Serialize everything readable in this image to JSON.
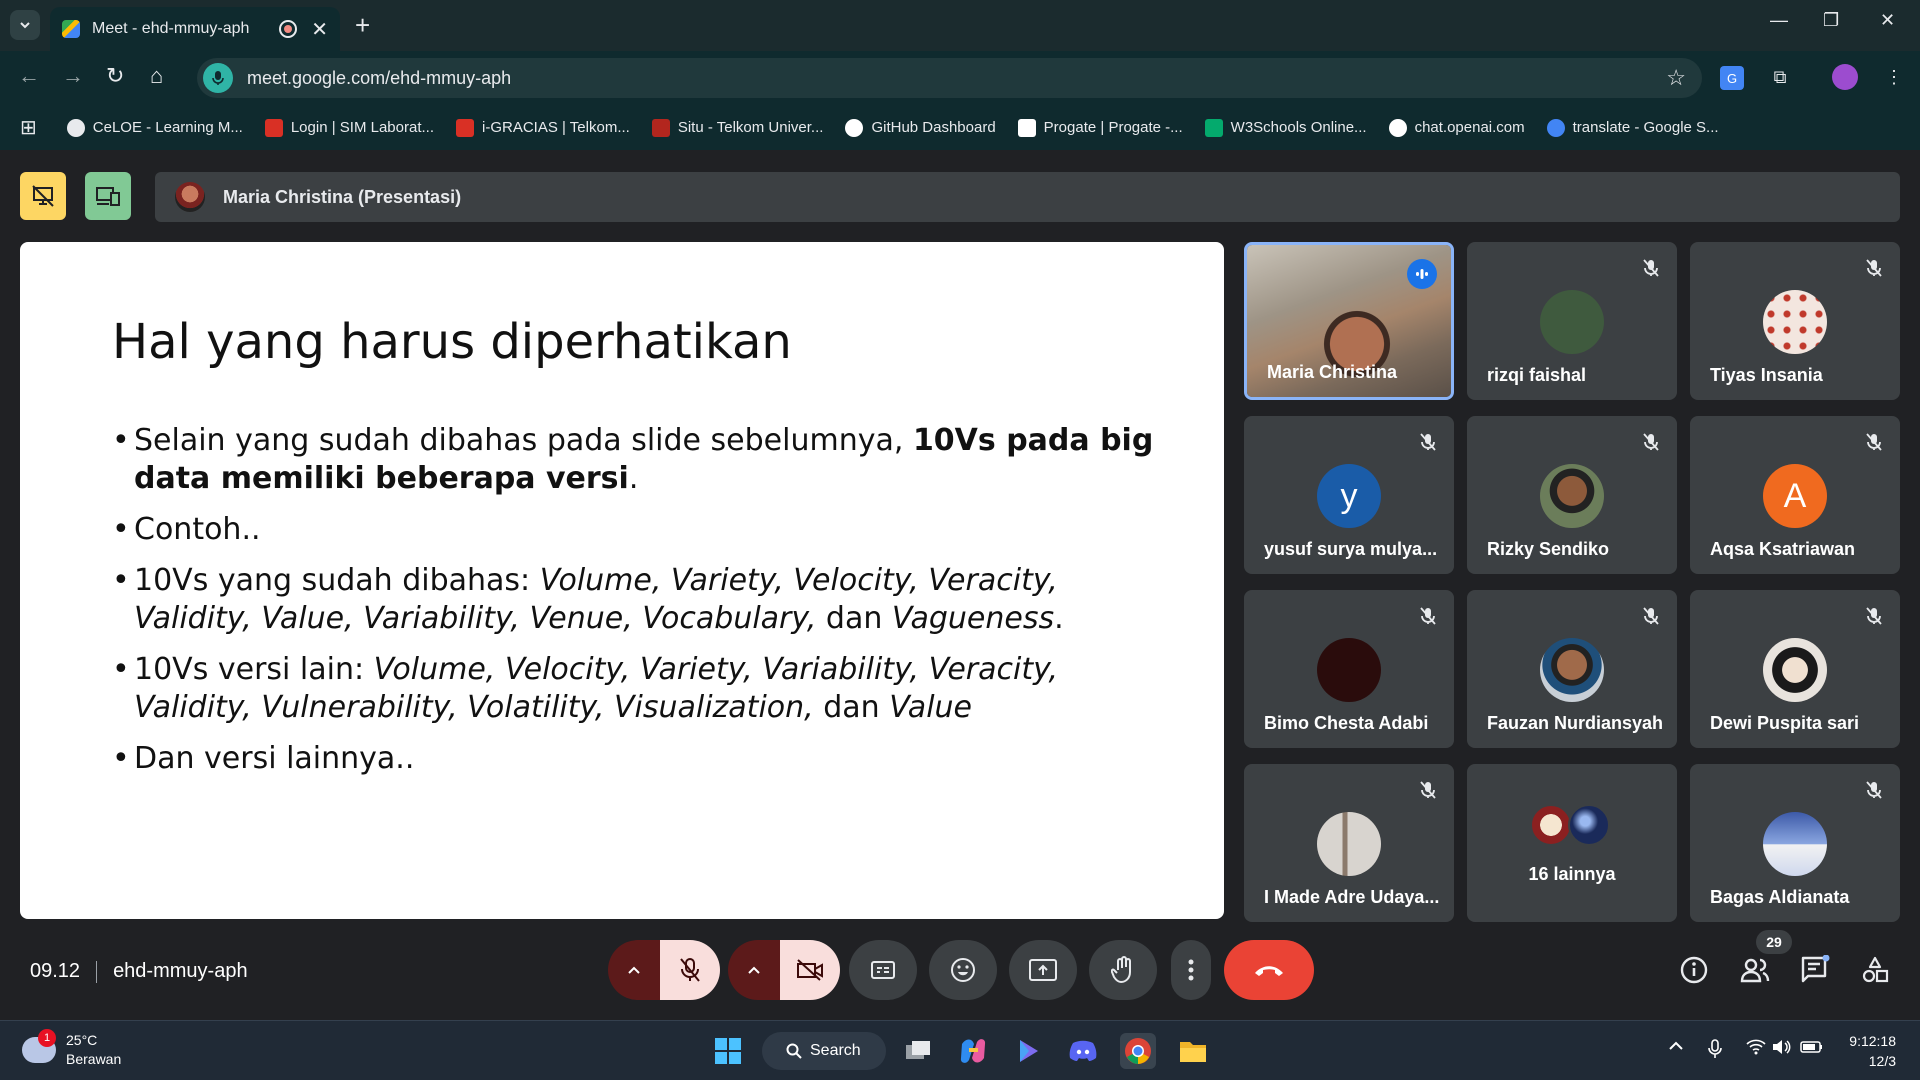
{
  "browser": {
    "tab_title": "Meet - ehd-mmuy-aph",
    "url": "meet.google.com/ehd-mmuy-aph",
    "bookmarks": [
      {
        "label": "CeLOE - Learning M...",
        "color": "#e8eaed"
      },
      {
        "label": "Login | SIM Laborat...",
        "color": "#d93025"
      },
      {
        "label": "i-GRACIAS | Telkom...",
        "color": "#d93025"
      },
      {
        "label": "Situ - Telkom Univer...",
        "color": "#b3261e"
      },
      {
        "label": "GitHub Dashboard",
        "color": "#ffffff"
      },
      {
        "label": "Progate | Progate -...",
        "color": "#ffffff"
      },
      {
        "label": "W3Schools Online...",
        "color": "#04aa6d"
      },
      {
        "label": "chat.openai.com",
        "color": "#ffffff"
      },
      {
        "label": "translate - Google S...",
        "color": "#4285f4"
      }
    ]
  },
  "meet": {
    "presenter_label": "Maria Christina (Presentasi)",
    "slide": {
      "title": "Hal yang harus diperhatikan",
      "bullet1_plain": "Selain yang sudah dibahas pada slide sebelumnya, ",
      "bullet1_bold": "10Vs pada big data memiliki beberapa versi",
      "bullet1_end": ".",
      "bullet2": "Contoh..",
      "bullet3_plain": "10Vs yang sudah dibahas:  ",
      "bullet3_italic": "Volume, Variety, Velocity, Veracity, Validity, Value, Variability, Venue, Vocabulary,",
      "bullet3_mid": " dan ",
      "bullet3_italic2": "Vagueness",
      "bullet3_end": ".",
      "bullet4_plain": "10Vs versi lain: ",
      "bullet4_italic": "Volume, Velocity, Variety, Variability, Veracity, Validity, Vulnerability, Volatility, Visualization,",
      "bullet4_mid": " dan ",
      "bullet4_italic2": "Value",
      "bullet5": "Dan versi lainnya.."
    },
    "participants": [
      {
        "name": "Maria Christina",
        "type": "video",
        "speaking": true
      },
      {
        "name": "rizqi faishal",
        "type": "photo",
        "color": "#3f5a3e"
      },
      {
        "name": "Tiyas Insania",
        "type": "photo",
        "color": "#f3e6df"
      },
      {
        "name": "yusuf surya mulya...",
        "type": "letter",
        "letter": "y",
        "color": "#1a5ca8"
      },
      {
        "name": "Rizky Sendiko",
        "type": "photo",
        "color": "#6b7d5a"
      },
      {
        "name": "Aqsa Ksatriawan",
        "type": "letter",
        "letter": "A",
        "color": "#f06a1f"
      },
      {
        "name": "Bimo Chesta Adabi",
        "type": "photo",
        "color": "#2a0c0c"
      },
      {
        "name": "Fauzan Nurdiansyah",
        "type": "photo",
        "color": "#c8cfd6"
      },
      {
        "name": "Dewi Puspita sari",
        "type": "photo",
        "color": "#e8e3dd"
      },
      {
        "name": "I Made Adre Udaya...",
        "type": "photo",
        "color": "#9a8f86"
      },
      {
        "name": "16 lainnya",
        "type": "more"
      },
      {
        "name": "Bagas Aldianata",
        "type": "photo",
        "color": "#6f8cc9"
      }
    ],
    "time": "09.12",
    "meeting_code": "ehd-mmuy-aph",
    "participant_count": "29"
  },
  "taskbar": {
    "weather_badge": "1",
    "temperature": "25°C",
    "condition": "Berawan",
    "search_label": "Search",
    "clock_time": "9:12:18",
    "clock_date": "12/3"
  }
}
